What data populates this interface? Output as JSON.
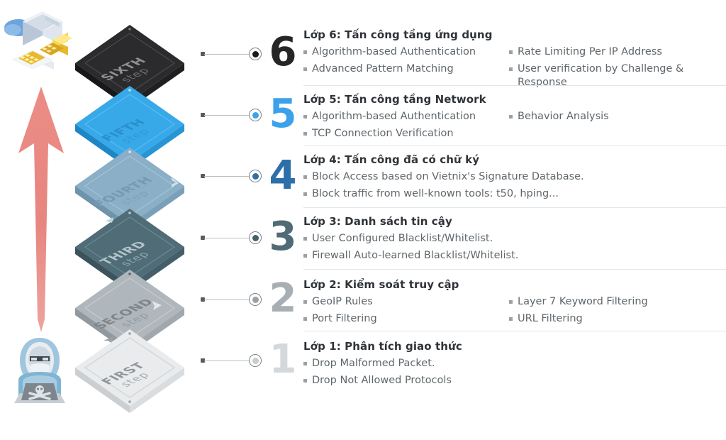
{
  "illustrations": {
    "top_left": {
      "name": "server-network-jack-illustration",
      "alt": "Isometric server with network jack and cloud"
    },
    "bottom_left": {
      "name": "hacker-illustration",
      "alt": "Hooded hacker at laptop with skull icon"
    },
    "arrow": {
      "name": "upward-attack-arrow",
      "color": "#E8857F",
      "direction": "up"
    }
  },
  "layers": [
    {
      "number": "6",
      "plate_word": "SIXTH",
      "plate_sub": "step",
      "plate_color": "#2B2B2D",
      "plate_side": "#18181A",
      "plate_text_color": "#8f9092",
      "number_color": "#262626",
      "dot_color": "#1c1c1c",
      "heading": "Lớp 6: Tấn công tầng ứng dụng",
      "col1": [
        "Algorithm-based Authentication",
        "Advanced Pattern Matching"
      ],
      "col2": [
        "Rate Limiting Per IP Address",
        "User verification by Challenge & Response"
      ]
    },
    {
      "number": "5",
      "plate_word": "FIFTH",
      "plate_sub": "step",
      "plate_color": "#37A9E8",
      "plate_side": "#1E86C4",
      "plate_text_color": "#2a8fc8",
      "number_color": "#3BA1EA",
      "dot_color": "#39A3E9",
      "heading": "Lớp 5: Tấn công tầng Network",
      "col1": [
        "Algorithm-based Authentication",
        "TCP Connection Verification"
      ],
      "col2": [
        "Behavior Analysis"
      ]
    },
    {
      "number": "4",
      "plate_word": "FOURTH",
      "plate_sub": "step",
      "plate_color": "#8AAFC6",
      "plate_side": "#6E93AB",
      "plate_text_color": "#7499b1",
      "number_color": "#2D6FA8",
      "dot_color": "#2D6FA8",
      "heading": "Lớp 4: Tấn công đã có chữ ký",
      "col1": [
        "Block Access based on Vietnix's Signature Database.",
        "Block traffic from well-known tools: t50, hping..."
      ],
      "col2": []
    },
    {
      "number": "3",
      "plate_word": "THIRD",
      "plate_sub": "step",
      "plate_color": "#4F6C77",
      "plate_side": "#3B535C",
      "plate_text_color": "#93a6ad",
      "number_color": "#4F6B75",
      "dot_color": "#45606A",
      "heading": "Lớp 3: Danh sách tin cậy",
      "col1": [
        "User Configured Blacklist/Whitelist.",
        "Firewall Auto-learned Blacklist/Whitelist."
      ],
      "col2": []
    },
    {
      "number": "2",
      "plate_word": "SECOND",
      "plate_sub": "step",
      "plate_color": "#B0B7BC",
      "plate_side": "#9199A0",
      "plate_text_color": "#8b949a",
      "number_color": "#A8AFB4",
      "dot_color": "#9AA1A6",
      "heading": "Lớp 2: Kiểm soát truy cập",
      "col1": [
        "GeoIP Rules",
        "Port Filtering"
      ],
      "col2": [
        "Layer 7 Keyword Filtering",
        "URL Filtering"
      ]
    },
    {
      "number": "1",
      "plate_word": "FIRST",
      "plate_sub": "step",
      "plate_color": "#E9EBEC",
      "plate_side": "#CBCFD2",
      "plate_text_color": "#a9aeb2",
      "number_color": "#D5D8DA",
      "dot_color": "#C9CDD0",
      "heading": "Lớp 1: Phân tích giao thức",
      "col1": [
        "Drop Malformed Packet.",
        "Drop Not Allowed Protocols"
      ],
      "col2": []
    }
  ]
}
